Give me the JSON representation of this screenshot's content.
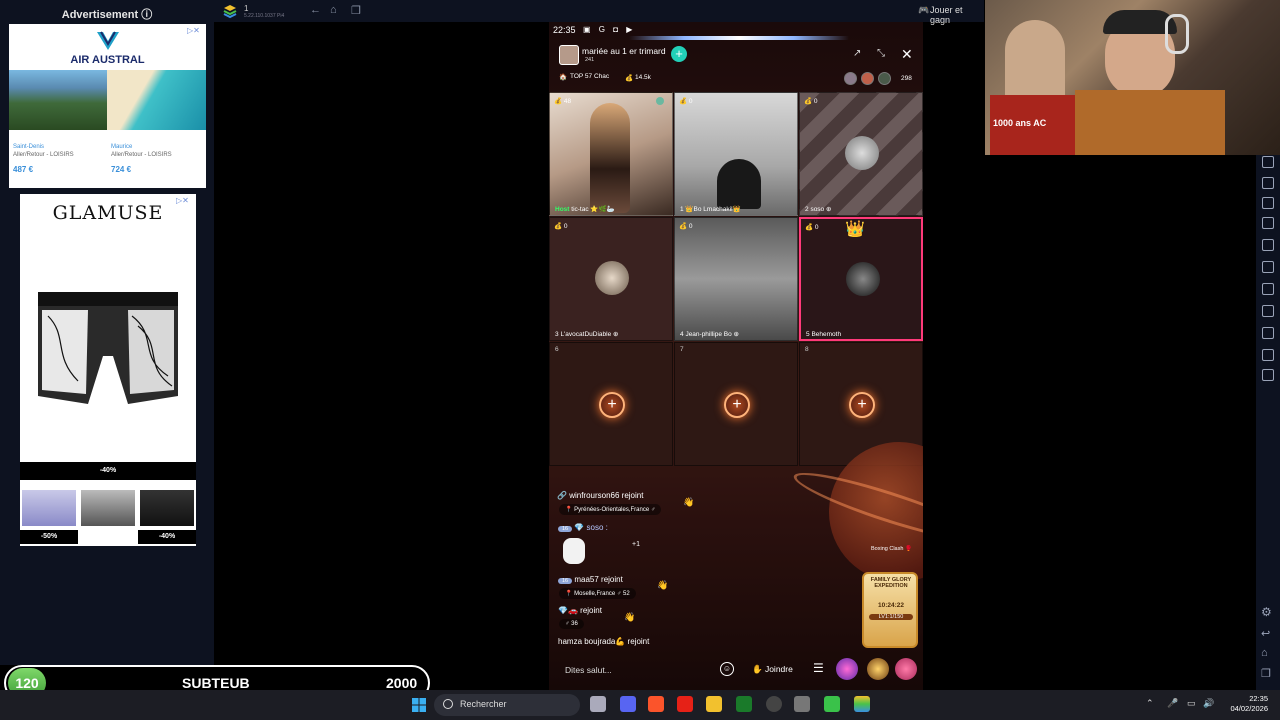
{
  "ads": {
    "header": "Advertisement ⓘ",
    "air_austral": {
      "brand": "AIR AUSTRAL",
      "offers": [
        {
          "city": "Saint-Denis",
          "trip": "Aller/Retour - LOISIRS",
          "price": "487 €"
        },
        {
          "city": "Maurice",
          "trip": "Aller/Retour - LOISIRS",
          "price": "724 €"
        }
      ]
    },
    "glamuse": {
      "brand": "GLAMUSE",
      "main_discount": "-40%",
      "discounts": [
        "-50%",
        "-40%"
      ]
    }
  },
  "emulator_bar": {
    "instance": "1",
    "address": "5.22.110.1037 Pi4",
    "play_label": "Jouer et gagn"
  },
  "webcam": {
    "caption": "1000 ans AC"
  },
  "app": {
    "status_time": "22:35",
    "room": {
      "title": "mariée  au 1 er trimard",
      "likes": "241",
      "top_label": "TOP 57 Chac",
      "coins": "14.5k",
      "viewers": "298"
    },
    "slots": [
      {
        "badge": "48",
        "name": "tic-tac",
        "prefix": "Host"
      },
      {
        "badge": "0",
        "name": "Bo Lmachakil",
        "prefix": "1"
      },
      {
        "badge": "0",
        "name": "soso",
        "prefix": "2"
      },
      {
        "badge": "0",
        "name": "L'avocatDuDiable",
        "prefix": "3"
      },
      {
        "badge": "0",
        "name": "Jean-phillipe Bo",
        "prefix": "4"
      },
      {
        "badge": "0",
        "name": "Behemoth",
        "prefix": "5"
      },
      {
        "num": "6"
      },
      {
        "num": "7"
      },
      {
        "num": "8"
      }
    ],
    "chat": {
      "line1": "winfrourson66 rejoint",
      "loc1": "Pyrénées-Orientales,France",
      "lvl1": "16",
      "line2": "soso :",
      "plus": "+1",
      "lvl2": "16",
      "line3": "maa57 rejoint",
      "loc3": "Moselle,France",
      "count3": "52",
      "line4": "rejoint",
      "count4": "36",
      "line5": "hamza boujrada💪 rejoint"
    },
    "boxing": "Boxing Clash",
    "expedition": {
      "title": "FAMILY GLORY EXPEDITION",
      "time": "10:24:22",
      "level": "LV1:1/150"
    },
    "input_placeholder": "Dites salut...",
    "join_label": "Joindre"
  },
  "overlay": {
    "count": "120",
    "label": "SUBTEUB",
    "goal": "2000"
  },
  "taskbar": {
    "search_label": "Rechercher",
    "time": "22:35",
    "date": "04/02/2026"
  }
}
